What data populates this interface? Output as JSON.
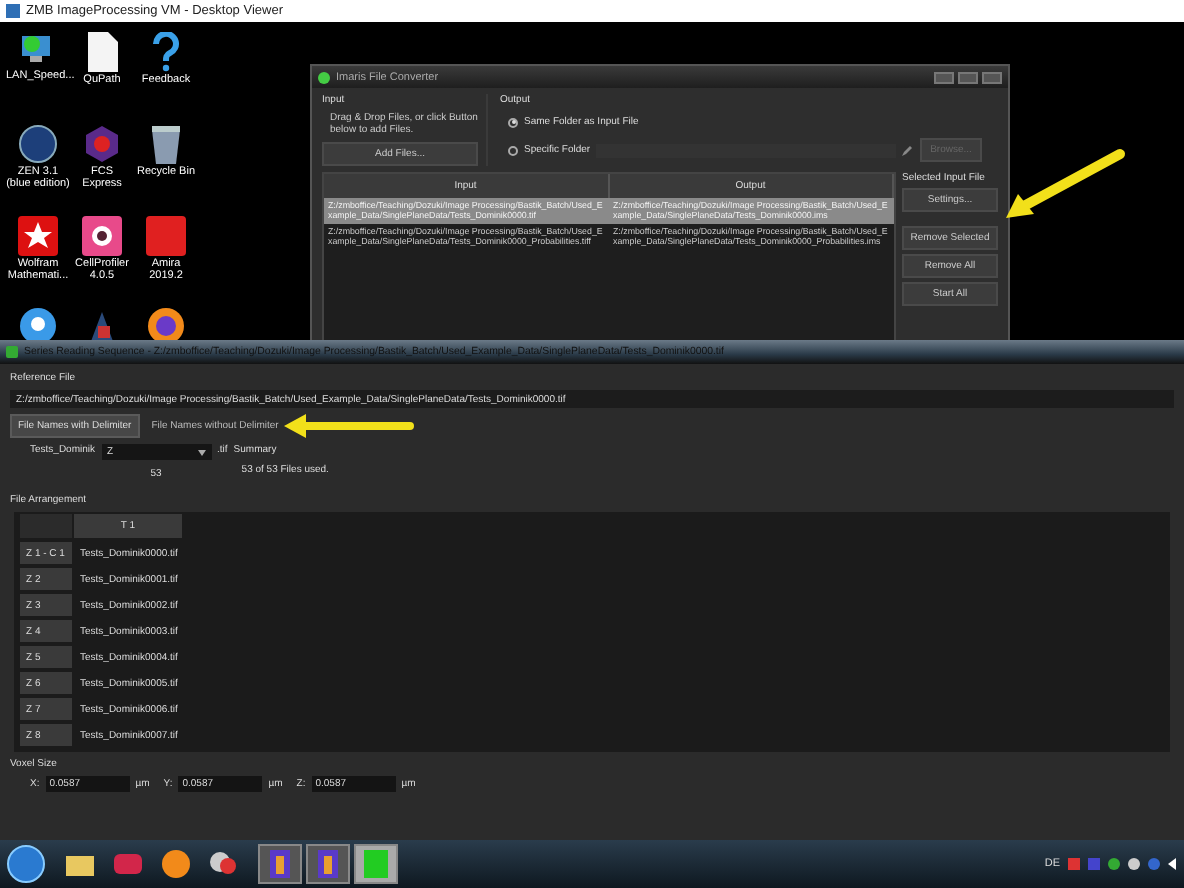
{
  "viewer": {
    "title": "ZMB ImageProcessing VM - Desktop Viewer"
  },
  "desktop_icons": [
    {
      "kind": "network",
      "label": "LAN_Speed..."
    },
    {
      "kind": "document",
      "label": "QuPath"
    },
    {
      "kind": "help",
      "label": "Feedback"
    },
    {
      "kind": "zen",
      "label": "ZEN 3.1 (blue edition)"
    },
    {
      "kind": "fcs",
      "label": "FCS Express"
    },
    {
      "kind": "bin",
      "label": "Recycle Bin"
    },
    {
      "kind": "wolfram",
      "label": "Wolfram Mathemati..."
    },
    {
      "kind": "cellprofiler",
      "label": "CellProfiler 4.0.5"
    },
    {
      "kind": "amira",
      "label": "Amira 2019.2"
    },
    {
      "kind": "bulb"
    },
    {
      "kind": "people"
    },
    {
      "kind": "browser"
    }
  ],
  "converter": {
    "title": "Imaris File Converter",
    "input_label": "Input",
    "hint": "Drag & Drop Files, or click Button below to add Files.",
    "add_button": "Add Files...",
    "output_label": "Output",
    "output_options": [
      {
        "label": "Same Folder as Input File",
        "selected": true
      },
      {
        "label": "Specific Folder",
        "selected": false
      }
    ],
    "browse_button": "Browse...",
    "columns": [
      "Input",
      "Output"
    ],
    "rows": [
      {
        "input": "Z:/zmboffice/Teaching/Dozuki/Image Processing/Bastik_Batch/Used_Example_Data/SinglePlaneData/Tests_Dominik0000.tif",
        "output": "Z:/zmboffice/Teaching/Dozuki/Image Processing/Bastik_Batch/Used_Example_Data/SinglePlaneData/Tests_Dominik0000.ims",
        "selected": true
      },
      {
        "input": "Z:/zmboffice/Teaching/Dozuki/Image Processing/Bastik_Batch/Used_Example_Data/SinglePlaneData/Tests_Dominik0000_Probabilities.tiff",
        "output": "Z:/zmboffice/Teaching/Dozuki/Image Processing/Bastik_Batch/Used_Example_Data/SinglePlaneData/Tests_Dominik0000_Probabilities.ims",
        "selected": false
      }
    ],
    "side_label": "Selected Input File",
    "settings_button": "Settings...",
    "buttons": [
      "Remove Selected",
      "Remove All",
      "Start All"
    ]
  },
  "series": {
    "title": "Series Reading Sequence - Z:/zmboffice/Teaching/Dozuki/Image Processing/Bastik_Batch/Used_Example_Data/SinglePlaneData/Tests_Dominik0000.tif",
    "reference_label": "Reference File",
    "reference_path": "Z:/zmboffice/Teaching/Dozuki/Image Processing/Bastik_Batch/Used_Example_Data/SinglePlaneData/Tests_Dominik0000.tif",
    "tabs": [
      {
        "label": "File Names with Delimiter",
        "selected": true
      },
      {
        "label": "File Names without Delimiter",
        "selected": false
      }
    ],
    "prefix": "Tests_Dominik",
    "dimension": "Z",
    "extension": ".tif",
    "count": "53",
    "summary_label": "Summary",
    "summary": "53 of 53 Files used.",
    "arrangement_label": "File Arrangement",
    "column": "T 1",
    "rows": [
      {
        "label": "Z 1 - C 1",
        "file": "Tests_Dominik0000.tif"
      },
      {
        "label": "Z 2",
        "file": "Tests_Dominik0001.tif"
      },
      {
        "label": "Z 3",
        "file": "Tests_Dominik0002.tif"
      },
      {
        "label": "Z 4",
        "file": "Tests_Dominik0003.tif"
      },
      {
        "label": "Z 5",
        "file": "Tests_Dominik0004.tif"
      },
      {
        "label": "Z 6",
        "file": "Tests_Dominik0005.tif"
      },
      {
        "label": "Z 7",
        "file": "Tests_Dominik0006.tif"
      },
      {
        "label": "Z 8",
        "file": "Tests_Dominik0007.tif"
      }
    ],
    "voxel_label": "Voxel Size",
    "voxel": [
      {
        "axis": "X:",
        "value": "0.0587",
        "unit": "µm"
      },
      {
        "axis": "Y:",
        "value": "0.0587",
        "unit": "µm"
      },
      {
        "axis": "Z:",
        "value": "0.0587",
        "unit": "µm"
      }
    ]
  },
  "taskbar": {
    "language": "DE"
  }
}
